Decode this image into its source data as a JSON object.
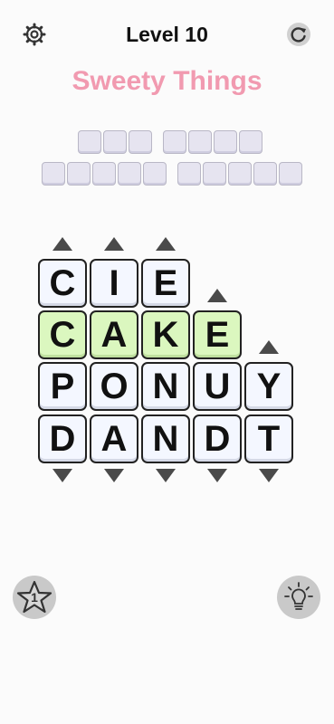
{
  "header": {
    "level_label": "Level 10",
    "settings_icon": "gear-icon",
    "restart_icon": "restart-icon"
  },
  "category": {
    "title": "Sweety Things",
    "color": "#f19ab0"
  },
  "answer_slots": {
    "row1_words": [
      3,
      4
    ],
    "row2_words": [
      5,
      5
    ]
  },
  "grid": {
    "columns": [
      {
        "up_arrow": true,
        "down_arrow": true,
        "letters": [
          "C",
          "C",
          "P",
          "D"
        ]
      },
      {
        "up_arrow": true,
        "down_arrow": true,
        "letters": [
          "I",
          "A",
          "O",
          "A"
        ]
      },
      {
        "up_arrow": true,
        "down_arrow": true,
        "letters": [
          "E",
          "K",
          "N",
          "N"
        ]
      },
      {
        "up_arrow": true,
        "down_arrow": true,
        "letters": [
          null,
          "E",
          "U",
          "D"
        ]
      },
      {
        "up_arrow": true,
        "down_arrow": true,
        "letters": [
          null,
          null,
          "Y",
          "T"
        ]
      }
    ],
    "found_row_index": 1,
    "found_color": "#dbf7bf"
  },
  "footer": {
    "star_count": "1",
    "star_icon": "star-icon",
    "hint_icon": "lightbulb-icon"
  }
}
